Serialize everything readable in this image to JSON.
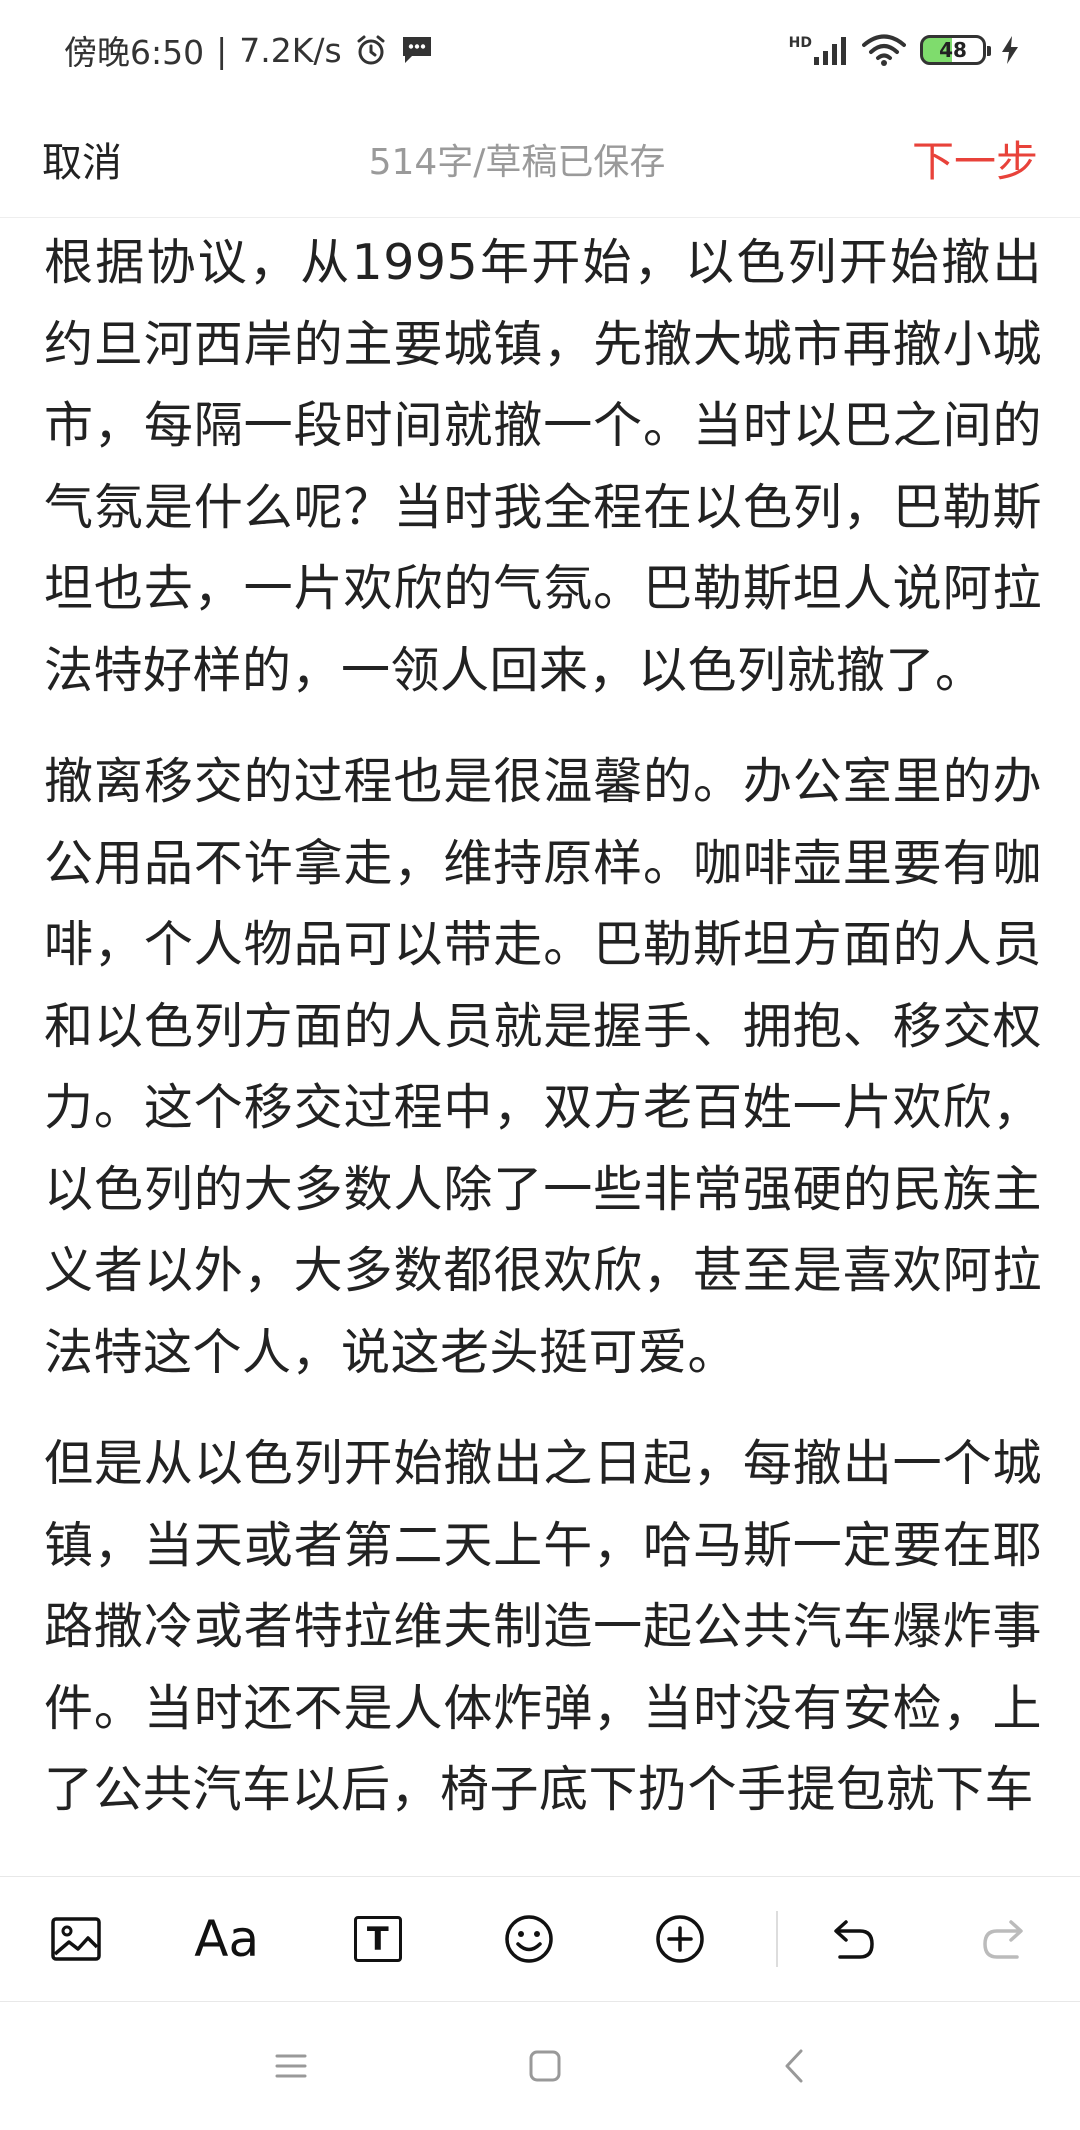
{
  "status_bar": {
    "time": "傍晚6:50",
    "separator": "|",
    "net_speed": "7.2K/s",
    "signal_label": "HD",
    "battery": "48",
    "battery_level_percent": 48
  },
  "top_bar": {
    "cancel_label": "取消",
    "doc_status": "514字/草稿已保存",
    "next_label": "下一步",
    "accent_color": "#e8423a"
  },
  "content": {
    "paragraphs": [
      "根据协议，从1995年开始，以色列开始撤出约旦河西岸的主要城镇，先撤大城市再撤小城市，每隔一段时间就撤一个。当时以巴之间的气氛是什么呢？当时我全程在以色列，巴勒斯坦也去，一片欢欣的气氛。巴勒斯坦人说阿拉法特好样的，一领人回来，以色列就撤了。",
      "撤离移交的过程也是很温馨的。办公室里的办公用品不许拿走，维持原样。咖啡壶里要有咖啡，个人物品可以带走。巴勒斯坦方面的人员和以色列方面的人员就是握手、拥抱、移交权力。这个移交过程中，双方老百姓一片欢欣，以色列的大多数人除了一些非常强硬的民族主义者以外，大多数都很欢欣，甚至是喜欢阿拉法特这个人，说这老头挺可爱。",
      "但是从以色列开始撤出之日起，每撤出一个城镇，当天或者第二天上午，哈马斯一定要在耶路撒冷或者特拉维夫制造一起公共汽车爆炸事件。当时还不是人体炸弹，当时没有安检，上了公共汽车以后，椅子底下扔个手提包就下车"
    ]
  },
  "toolbar": {
    "icons": [
      "image-icon",
      "font-icon",
      "text-box-icon",
      "emoji-icon",
      "add-icon",
      "undo-icon",
      "redo-icon"
    ],
    "font_label": "Aa",
    "text_box_label": "T"
  },
  "nav_bar": {
    "icons": [
      "menu-icon",
      "home-icon",
      "back-icon"
    ]
  }
}
